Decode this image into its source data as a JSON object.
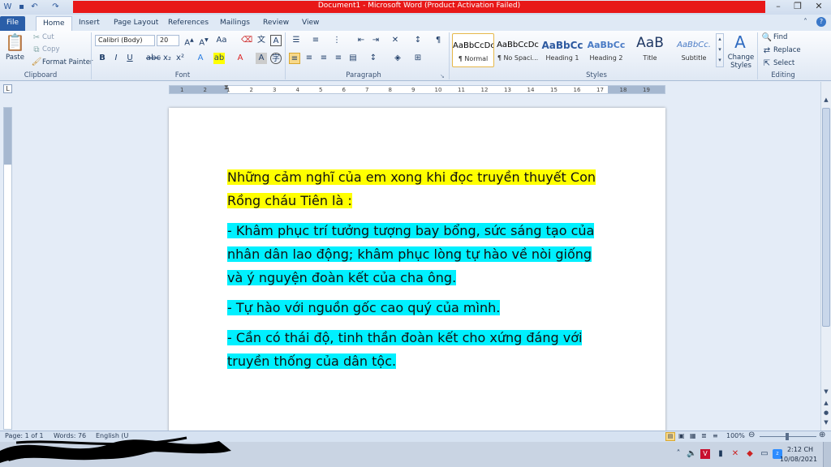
{
  "window": {
    "title": "Document1 - Microsoft Word (Product Activation Failed)",
    "minimize_icon": "minimize-icon",
    "maximize_icon": "restore-icon",
    "close_icon": "close-icon"
  },
  "tabs": [
    "File",
    "Home",
    "Insert",
    "Page Layout",
    "References",
    "Mailings",
    "Review",
    "View"
  ],
  "clipboard": {
    "paste": "Paste",
    "cut": "Cut",
    "copy": "Copy",
    "format_painter": "Format Painter",
    "group": "Clipboard"
  },
  "font": {
    "name": "Calibri (Body)",
    "size": "20",
    "group": "Font"
  },
  "paragraph": {
    "group": "Paragraph"
  },
  "styles": {
    "group": "Styles",
    "items": [
      {
        "preview": "AaBbCcDc",
        "name": "¶ Normal"
      },
      {
        "preview": "AaBbCcDc",
        "name": "¶ No Spaci..."
      },
      {
        "preview": "AaBbCc",
        "name": "Heading 1"
      },
      {
        "preview": "AaBbCc",
        "name": "Heading 2"
      },
      {
        "preview": "AaB",
        "name": "Title"
      },
      {
        "preview": "AaBbCc.",
        "name": "Subtitle"
      }
    ],
    "change_styles": "Change Styles"
  },
  "editing": {
    "find": "Find",
    "replace": "Replace",
    "select": "Select",
    "group": "Editing"
  },
  "ruler": {
    "numbers": [
      "1",
      "2",
      "1",
      "2",
      "3",
      "4",
      "5",
      "6",
      "7",
      "8",
      "9",
      "10",
      "11",
      "12",
      "13",
      "14",
      "15",
      "16",
      "17",
      "18",
      "19"
    ]
  },
  "document": {
    "paragraphs": [
      {
        "text": "Những cảm nghĩ của em xong khi đọc truyền thuyết Con Rồng cháu Tiên là :",
        "highlight": "#ffff00"
      },
      {
        "text": "- Khâm phục trí tưởng tượng bay bổng, sức sáng tạo của nhân dân lao động; khâm phục lòng tự hào về nòi giống và ý nguyện đoàn kết của cha ông.",
        "highlight": "#00f0ff"
      },
      {
        "text": "- Tự hào với nguồn gốc cao quý của mình.",
        "highlight": "#00f0ff"
      },
      {
        "text": "- Cần có thái độ, tinh thần đoàn kết cho xứng đáng với truyền thống của dân tộc.",
        "highlight": "#00f0ff"
      }
    ]
  },
  "status": {
    "page": "Page: 1 of 1",
    "words": "Words: 76",
    "language": "English (U",
    "zoom": "100%"
  },
  "taskbar": {
    "time": "2:12 CH",
    "date": "10/08/2021"
  }
}
